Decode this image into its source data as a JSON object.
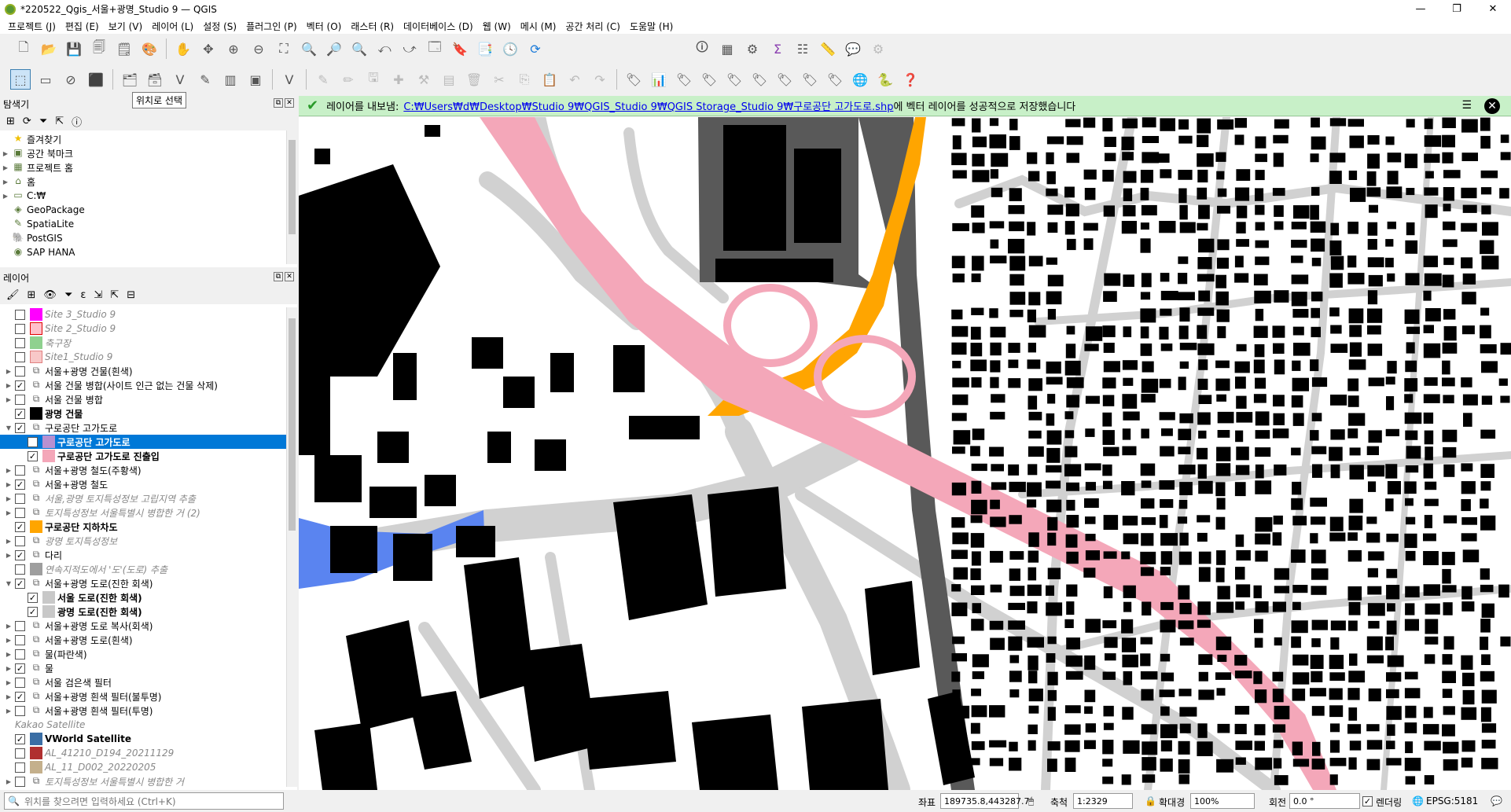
{
  "window": {
    "title": "*220522_Qgis_서울+광명_Studio 9 — QGIS",
    "min": "—",
    "max": "❐",
    "close": "✕"
  },
  "menu": [
    "프로젝트 (J)",
    "편집 (E)",
    "보기 (V)",
    "레이어 (L)",
    "설정 (S)",
    "플러그인 (P)",
    "벡터 (O)",
    "래스터 (R)",
    "데이터베이스 (D)",
    "웹 (W)",
    "메시 (M)",
    "공간 처리 (C)",
    "도움말 (H)"
  ],
  "tooltip": "위치로 선택",
  "browser": {
    "title": "탐색기",
    "items": [
      {
        "label": "즐겨찾기",
        "icon": "star-icon"
      },
      {
        "label": "공간 북마크",
        "icon": "bookmark-icon"
      },
      {
        "label": "프로젝트 홈",
        "icon": "project-home-icon"
      },
      {
        "label": "홈",
        "icon": "home-icon"
      },
      {
        "label": "C:₩",
        "icon": "drive-icon"
      },
      {
        "label": "GeoPackage",
        "icon": "geopackage-icon"
      },
      {
        "label": "SpatiaLite",
        "icon": "spatialite-icon"
      },
      {
        "label": "PostGIS",
        "icon": "postgis-icon"
      },
      {
        "label": "SAP HANA",
        "icon": "hana-icon"
      }
    ]
  },
  "layers_panel": {
    "title": "레이어",
    "items": [
      {
        "label": "Site 3_Studio 9",
        "indent": 1,
        "checked": false,
        "color": "#ff00ff",
        "style": "it"
      },
      {
        "label": "Site 2_Studio 9",
        "indent": 1,
        "checked": false,
        "color": "#ffc0cb",
        "style": "it",
        "border": "#e00000"
      },
      {
        "label": "축구장",
        "indent": 1,
        "checked": false,
        "color": "#8fd18f",
        "style": "it"
      },
      {
        "label": "Site1_Studio 9",
        "indent": 1,
        "checked": false,
        "color": "#f8c8c8",
        "style": "it",
        "border": "#e08080"
      },
      {
        "label": "서울+광명 건물(흰색)",
        "indent": 1,
        "checked": false,
        "group": true
      },
      {
        "label": "서울 건물 병합(사이트 인근 없는 건물 삭제)",
        "indent": 1,
        "checked": true,
        "group": true
      },
      {
        "label": "서울 건물 병합",
        "indent": 1,
        "checked": false,
        "group": true
      },
      {
        "label": "광명 건물",
        "indent": 1,
        "checked": true,
        "color": "#000000",
        "style": "bold"
      },
      {
        "label": "구로공단 고가도로",
        "indent": 1,
        "checked": true,
        "group": true,
        "expanded": true
      },
      {
        "label": "구로공단 고가도로",
        "indent": 2,
        "checked": true,
        "color": "#b890d0",
        "style": "bold",
        "selected": true
      },
      {
        "label": "구로공단 고가도로 진출입",
        "indent": 2,
        "checked": true,
        "color": "#f4a7b9",
        "style": "bold"
      },
      {
        "label": "서울+광명 철도(주황색)",
        "indent": 1,
        "checked": false,
        "group": true
      },
      {
        "label": "서울+광명 철도",
        "indent": 1,
        "checked": true,
        "group": true
      },
      {
        "label": "서울,광명 토지특성정보 고립지역 추출",
        "indent": 1,
        "checked": false,
        "group": true,
        "style": "it"
      },
      {
        "label": "토지특성정보 서울특별시 병합한 거 (2)",
        "indent": 1,
        "checked": false,
        "group": true,
        "style": "it"
      },
      {
        "label": "구로공단 지하차도",
        "indent": 1,
        "checked": true,
        "color": "#ffa500",
        "style": "bold"
      },
      {
        "label": "광명 토지특성정보",
        "indent": 1,
        "checked": false,
        "group": true,
        "style": "it"
      },
      {
        "label": "다리",
        "indent": 1,
        "checked": true,
        "group": true
      },
      {
        "label": "연속지적도에서 '도'(도로) 추출",
        "indent": 1,
        "checked": false,
        "color": "#9e9e9e",
        "style": "it"
      },
      {
        "label": "서울+광명 도로(진한 회색)",
        "indent": 1,
        "checked": true,
        "group": true,
        "expanded": true
      },
      {
        "label": "서울 도로(진한 회색)",
        "indent": 2,
        "checked": true,
        "color": "#c8c8c8",
        "style": "bold"
      },
      {
        "label": "광명 도로(진한 회색)",
        "indent": 2,
        "checked": true,
        "color": "#c8c8c8",
        "style": "bold"
      },
      {
        "label": "서울+광명 도로 복사(회색)",
        "indent": 1,
        "checked": false,
        "group": true
      },
      {
        "label": "서울+광명 도로(흰색)",
        "indent": 1,
        "checked": false,
        "group": true
      },
      {
        "label": "물(파란색)",
        "indent": 1,
        "checked": false,
        "group": true
      },
      {
        "label": "물",
        "indent": 1,
        "checked": true,
        "group": true
      },
      {
        "label": "서울 검은색 필터",
        "indent": 1,
        "checked": false,
        "group": true
      },
      {
        "label": "서울+광명 흰색 필터(불투명)",
        "indent": 1,
        "checked": true,
        "group": true
      },
      {
        "label": "서울+광명 흰색 필터(투명)",
        "indent": 1,
        "checked": false,
        "group": true
      },
      {
        "label": "Kakao Satellite",
        "indent": 1,
        "checked": null,
        "style": "it"
      },
      {
        "label": "VWorld Satellite",
        "indent": 1,
        "checked": true,
        "color": "#3a6ea5",
        "style": "bold"
      },
      {
        "label": "AL_41210_D194_20211129",
        "indent": 1,
        "checked": false,
        "color": "#b03030",
        "style": "it"
      },
      {
        "label": "AL_11_D002_20220205",
        "indent": 1,
        "checked": false,
        "color": "#c4b08c",
        "style": "it"
      },
      {
        "label": "토지특성정보 서울특별시 병합한 거",
        "indent": 1,
        "checked": false,
        "group": true,
        "style": "it"
      }
    ]
  },
  "message": {
    "prefix": "레이어를 내보냄:",
    "link": "C:₩Users₩d₩Desktop₩Studio 9₩QGIS_Studio 9₩QGIS Storage_Studio 9₩구로공단 고가도로.shp",
    "suffix": "에 벡터 레이어를 성공적으로 저장했습니다"
  },
  "status": {
    "locator_placeholder": "위치를 찾으려면 입력하세요 (Ctrl+K)",
    "coord_label": "좌표",
    "coord_value": "189735.8,443287.7",
    "scale_label": "축척",
    "scale_value": "1:2329",
    "magnifier_label": "확대경",
    "magnifier_value": "100%",
    "rotation_label": "회전",
    "rotation_value": "0.0 °",
    "render_label": "렌더링",
    "crs": "EPSG:5181"
  },
  "colors": {
    "road": "#d1d1d1",
    "railway": "#595959",
    "overpass": "#f4a7b9",
    "underpass": "#ffa500",
    "water": "#5a84f0",
    "building": "#000000",
    "message_bg": "#c8f0c8"
  }
}
